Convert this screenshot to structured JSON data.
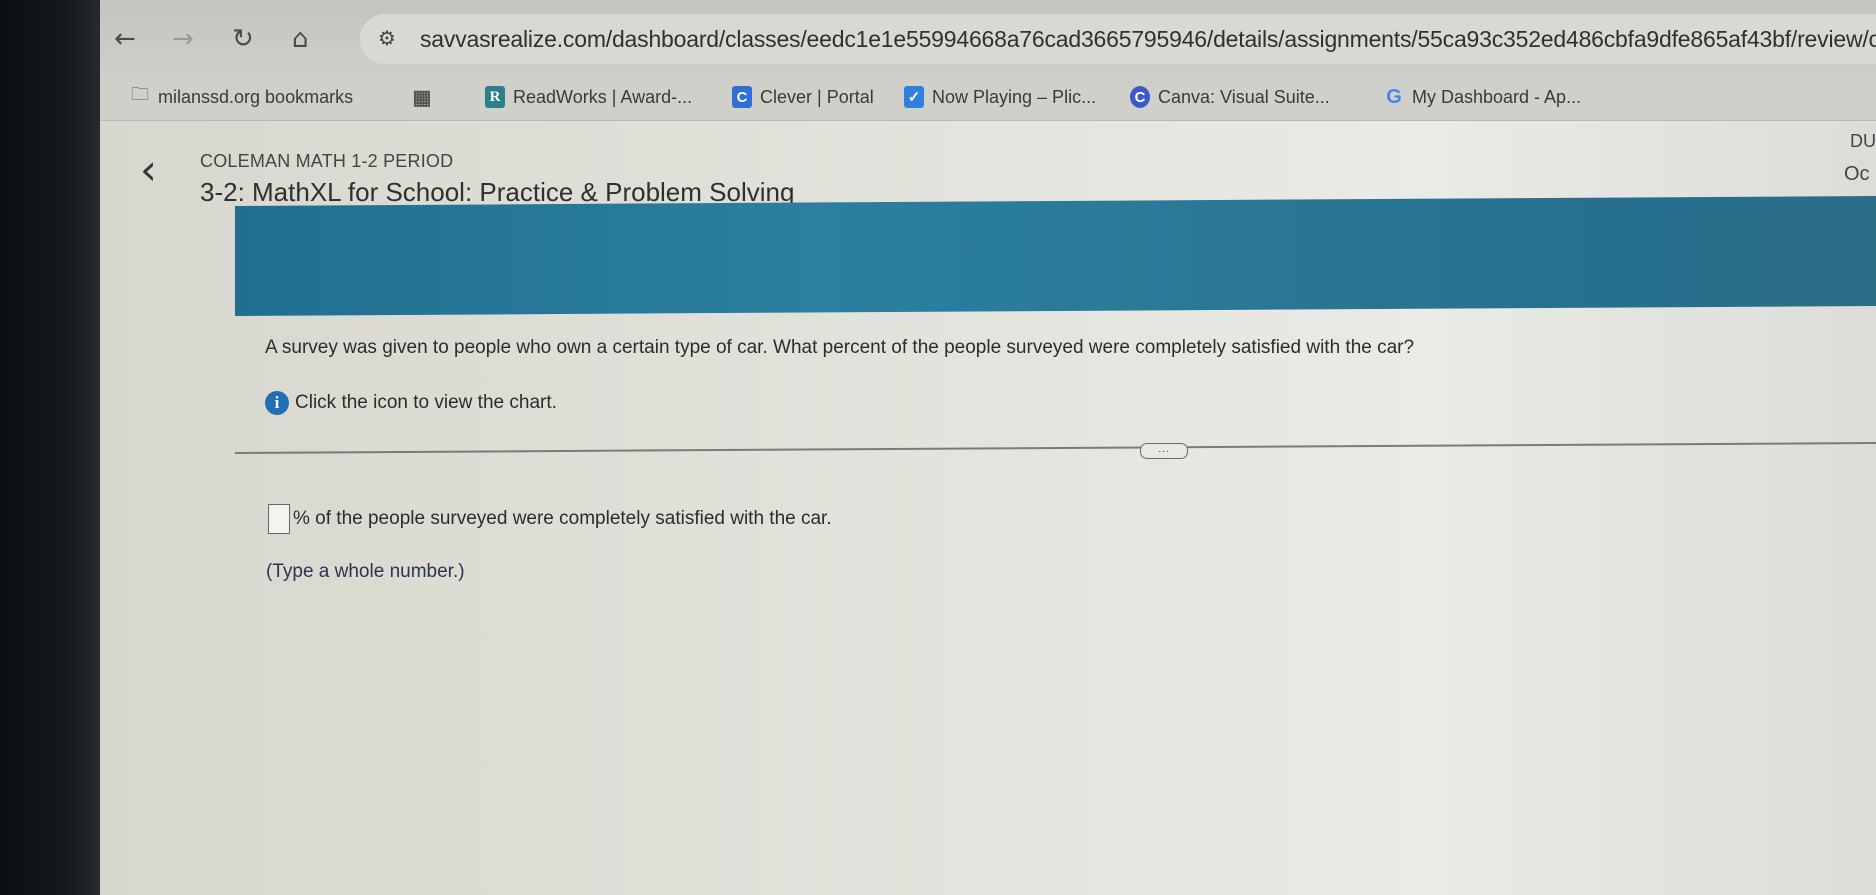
{
  "browser": {
    "nav": {
      "back_icon": "←",
      "forward_icon": "→",
      "reload_icon": "↻",
      "home_icon": "⌂",
      "site_info_icon": "⚙"
    },
    "url": "savvasrealize.com/dashboard/classes/eedc1e1e55994668a76cad3665795946/details/assignments/55ca93c352ed486cbfa9dfe865af43bf/review/co",
    "bookmarks": [
      {
        "label": "milanssd.org bookmarks",
        "icon": "folder-icon",
        "glyph": "🗀"
      },
      {
        "label": "",
        "icon": "apps-grid-icon",
        "glyph": "▦"
      },
      {
        "label": "ReadWorks | Award-...",
        "icon": "readworks-icon",
        "glyph": "R"
      },
      {
        "label": "Clever | Portal",
        "icon": "clever-icon",
        "glyph": "C"
      },
      {
        "label": "Now Playing – Plic...",
        "icon": "checkmark-icon",
        "glyph": "✓"
      },
      {
        "label": "Canva: Visual Suite...",
        "icon": "canva-icon",
        "glyph": "C"
      },
      {
        "label": "My Dashboard - Ap...",
        "icon": "google-icon",
        "glyph": "G"
      }
    ]
  },
  "header": {
    "back_glyph": "‹",
    "class_name": "COLEMAN MATH 1-2 PERIOD",
    "assignment_title": "3-2: MathXL for School: Practice & Problem Solving",
    "due_label": "DU",
    "due_value": "Oc"
  },
  "problem": {
    "question": "A survey was given to people who own a certain type of car. What percent of the people surveyed were completely satisfied with the car?",
    "info_glyph": "i",
    "chart_hint": "Click the icon to view the chart.",
    "more_button": "...",
    "answer_value": "",
    "answer_suffix": "% of the people surveyed were completely satisfied with the car.",
    "instruction": "(Type a whole number.)"
  },
  "colors": {
    "banner": "#2b7fa0",
    "info_icon": "#1f6fb4"
  }
}
